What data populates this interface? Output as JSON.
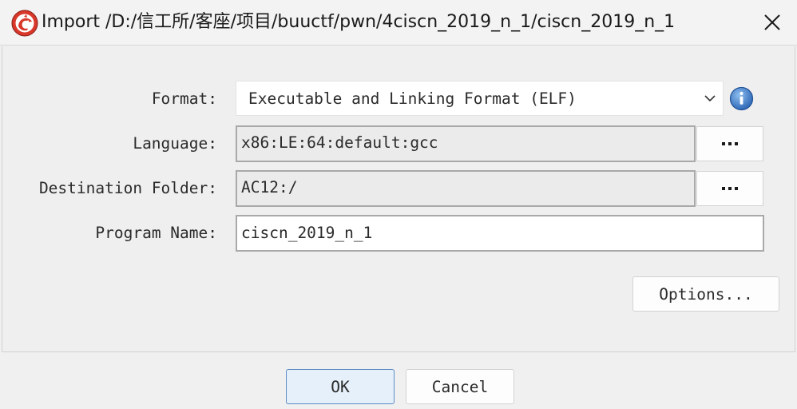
{
  "window": {
    "title": "Import /D:/信工所/客座/项目/buuctf/pwn/4ciscn_2019_n_1/ciscn_2019_n_1"
  },
  "form": {
    "format": {
      "label": "Format:",
      "value": "Executable and Linking Format (ELF)"
    },
    "language": {
      "label": "Language:",
      "value": "x86:LE:64:default:gcc",
      "browse_label": "..."
    },
    "destination": {
      "label": "Destination Folder:",
      "value": "AC12:/",
      "browse_label": "..."
    },
    "program_name": {
      "label": "Program Name:",
      "value": "ciscn_2019_n_1"
    },
    "options_label": "Options..."
  },
  "footer": {
    "ok_label": "OK",
    "cancel_label": "Cancel"
  },
  "icons": {
    "app": "ghidra-dragon-icon",
    "close": "close-icon",
    "dropdown": "chevron-down-icon",
    "info": "info-icon"
  },
  "colors": {
    "info_blue": "#3d7ac9",
    "app_red": "#d8372a",
    "primary_border": "#5a8bc4"
  }
}
